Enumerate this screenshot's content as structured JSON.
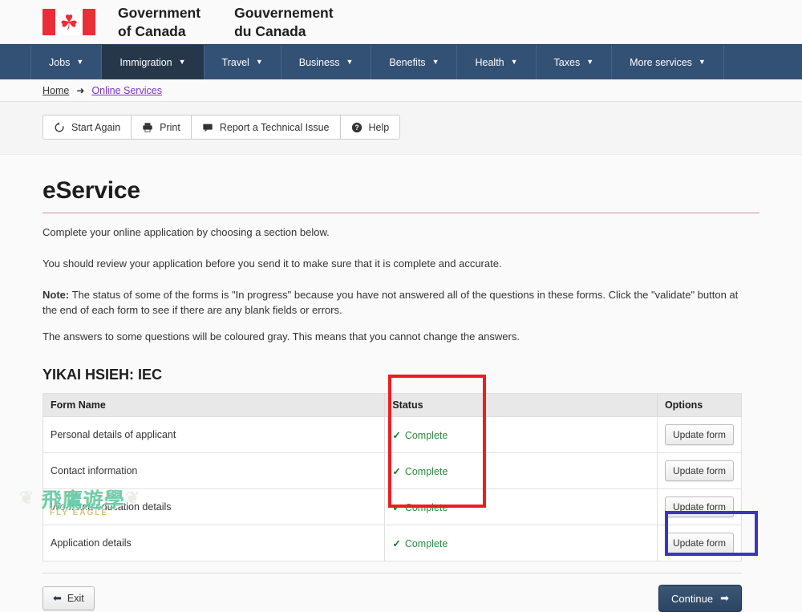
{
  "brand": {
    "flag_icon": "canada-flag-icon",
    "maple_leaf_glyph": "☘",
    "wordmark_en": "Government\nof Canada",
    "wordmark_fr": "Gouvernement\ndu Canada"
  },
  "nav": {
    "caret_glyph": "▼",
    "items": [
      {
        "label": "Jobs",
        "active": false
      },
      {
        "label": "Immigration",
        "active": true
      },
      {
        "label": "Travel",
        "active": false
      },
      {
        "label": "Business",
        "active": false
      },
      {
        "label": "Benefits",
        "active": false
      },
      {
        "label": "Health",
        "active": false
      },
      {
        "label": "Taxes",
        "active": false
      },
      {
        "label": "More services",
        "active": false
      }
    ]
  },
  "breadcrumb": {
    "home": "Home",
    "arrow_glyph": "➜",
    "current": "Online Services"
  },
  "toolbar": {
    "start_again": "Start Again",
    "print": "Print",
    "report_issue": "Report a Technical Issue",
    "help": "Help"
  },
  "page": {
    "title": "eService",
    "intro": "Complete your online application by choosing a section below.",
    "review": "You should review your application before you send it to make sure that it is complete and accurate.",
    "note_label": "Note:",
    "note_text": " The status of some of the forms is \"In progress\" because you have not answered all of the questions in these forms. Click the \"validate\" button at the end of each form to see if there are any blank fields or errors.",
    "gray_note": "The answers to some questions will be coloured gray. This means that you cannot change the answers.",
    "applicant": "YIKAI HSIEH: IEC"
  },
  "table": {
    "columns": [
      "Form Name",
      "Status",
      "Options"
    ],
    "check_glyph": "✓",
    "rows": [
      {
        "name": "Personal details of applicant",
        "status": "Complete",
        "option": "Update form"
      },
      {
        "name": "Contact information",
        "status": "Complete",
        "option": "Update form"
      },
      {
        "name": "Work and education details",
        "status": "Complete",
        "option": "Update form"
      },
      {
        "name": "Application details",
        "status": "Complete",
        "option": "Update form"
      }
    ]
  },
  "footer": {
    "exit_label": "Exit",
    "exit_arrow": "⬅",
    "continue_label": "Continue",
    "continue_arrow": "➡"
  },
  "watermark": {
    "chinese": "飛鷹遊學",
    "english": "FLY EAGLE",
    "wing_glyph": "❦"
  },
  "colors": {
    "nav_blue": "#335075",
    "nav_active": "#26374a",
    "rule_maroon": "#af3c43",
    "complete_green": "#2e8b40",
    "annotation_red": "#ee1c23",
    "annotation_blue": "#3b36bf",
    "visited_link": "#7834bc"
  }
}
